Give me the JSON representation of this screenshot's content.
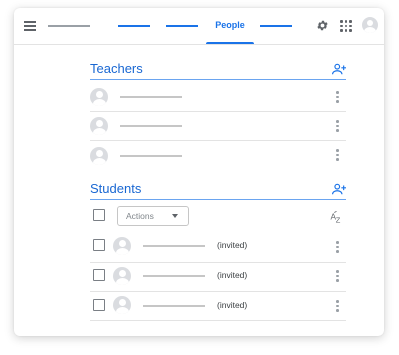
{
  "header": {
    "active_tab": "People",
    "colors": {
      "accent": "#1a73e8",
      "heading": "#1967d2",
      "icon": "#5f6368"
    },
    "icons": [
      "menu-icon",
      "settings-gear-icon",
      "apps-grid-icon",
      "account-avatar-icon"
    ]
  },
  "teachers": {
    "title": "Teachers",
    "rows": 3,
    "add_icon": "add-person-icon"
  },
  "students": {
    "title": "Students",
    "actions_label": "Actions",
    "sort_icon": "sort-az-icon",
    "add_icon": "add-person-icon",
    "rows": [
      {
        "status": "(invited)"
      },
      {
        "status": "(invited)"
      },
      {
        "status": "(invited)"
      }
    ]
  }
}
